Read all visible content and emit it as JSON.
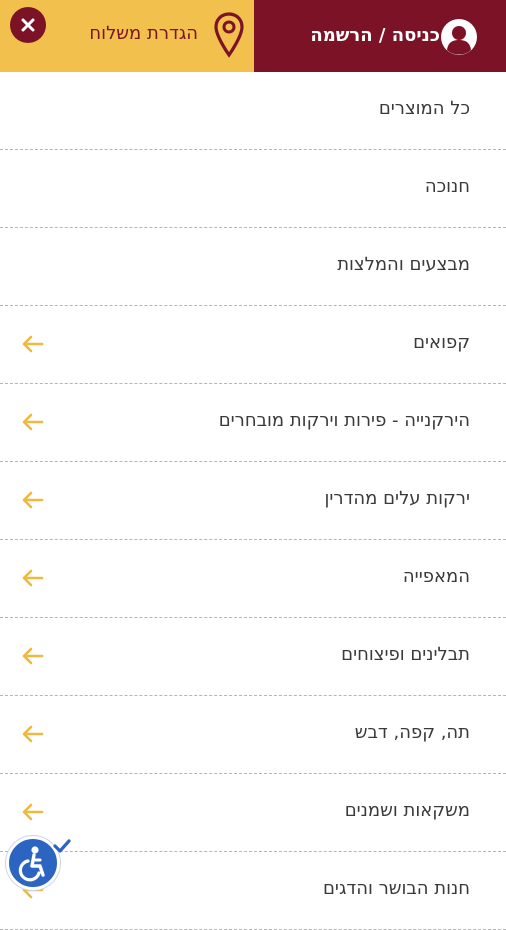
{
  "header": {
    "account_label": "כניסה / הרשמה",
    "shipping_label": "הגדרת משלוח",
    "close_icon": "close-icon",
    "pin_icon": "map-pin-icon",
    "user_icon": "user-avatar-icon"
  },
  "colors": {
    "brand_maroon": "#7b1225",
    "brand_yellow": "#f2c04d",
    "arrow": "#eeb93f",
    "accessibility": "#2c65c1"
  },
  "menu": {
    "items": [
      {
        "label": "כל המוצרים",
        "has_arrow": false
      },
      {
        "label": "חנוכה",
        "has_arrow": false
      },
      {
        "label": "מבצעים והמלצות",
        "has_arrow": false
      },
      {
        "label": "קפואים",
        "has_arrow": true
      },
      {
        "label": "הירקנייה - פירות וירקות מובחרים",
        "has_arrow": true
      },
      {
        "label": "ירקות עלים מהדרין",
        "has_arrow": true
      },
      {
        "label": "המאפייה",
        "has_arrow": true
      },
      {
        "label": "תבלינים ופיצוחים",
        "has_arrow": true
      },
      {
        "label": "תה, קפה, דבש",
        "has_arrow": true
      },
      {
        "label": "משקאות ושמנים",
        "has_arrow": true
      },
      {
        "label": "חנות הבושר והדגים",
        "has_arrow": true
      }
    ]
  },
  "accessibility": {
    "icon": "wheelchair-icon"
  }
}
